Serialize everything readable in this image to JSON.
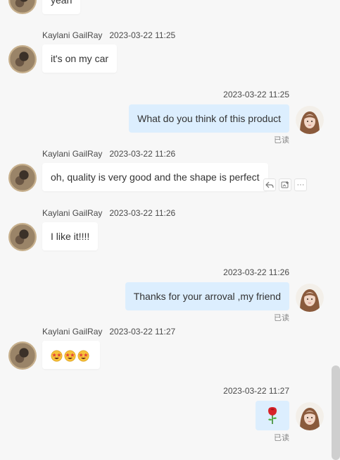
{
  "messages": [
    {
      "side": "left",
      "text": "yeah",
      "sender": "",
      "time": ""
    },
    {
      "side": "left",
      "sender": "Kaylani GailRay",
      "time": "2023-03-22 11:25",
      "text": "it's on my car"
    },
    {
      "side": "right",
      "time": "2023-03-22 11:25",
      "text": "What do you think of this product",
      "status": "已读"
    },
    {
      "side": "left",
      "sender": "Kaylani GailRay",
      "time": "2023-03-22 11:26",
      "text": "oh, quality is very good and the shape is perfect"
    },
    {
      "side": "left",
      "sender": "Kaylani GailRay",
      "time": "2023-03-22 11:26",
      "text": "I like it!!!!"
    },
    {
      "side": "right",
      "time": "2023-03-22 11:26",
      "text": "Thanks for your arroval ,my friend",
      "status": "已读"
    },
    {
      "side": "left",
      "sender": "Kaylani GailRay",
      "time": "2023-03-22 11:27",
      "text": ""
    },
    {
      "side": "right",
      "time": "2023-03-22 11:27",
      "text": "",
      "status": "已读"
    }
  ],
  "message_actions": {
    "reply_icon": "reply-icon",
    "add_icon": "add-to-note-icon",
    "more_label": "···"
  },
  "emojis": {
    "star_struck": "star-struck-emoji",
    "rose": "rose-emoji"
  },
  "colors": {
    "background": "#f7f7f7",
    "incoming_bubble": "#ffffff",
    "outgoing_bubble": "#dceefe"
  }
}
